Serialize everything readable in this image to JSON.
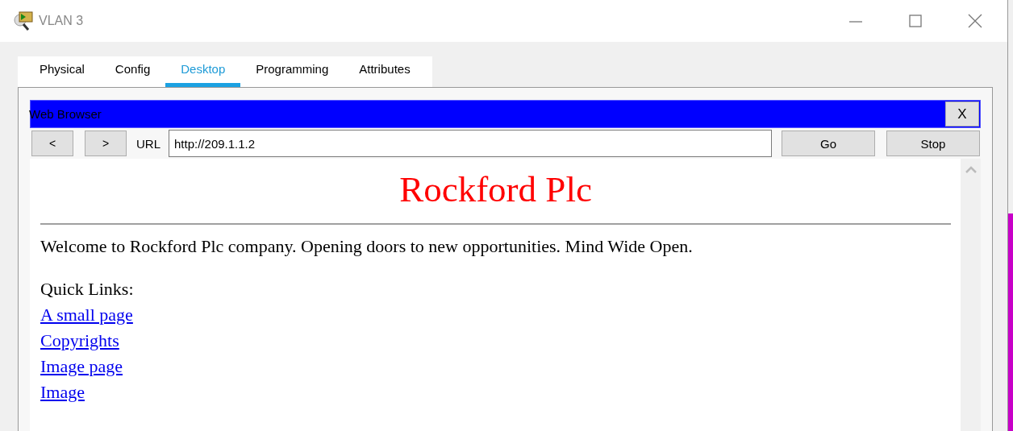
{
  "window": {
    "title": "VLAN 3"
  },
  "tabs": [
    {
      "label": "Physical",
      "selected": false
    },
    {
      "label": "Config",
      "selected": false
    },
    {
      "label": "Desktop",
      "selected": true
    },
    {
      "label": "Programming",
      "selected": false
    },
    {
      "label": "Attributes",
      "selected": false
    }
  ],
  "browser": {
    "title": "Web Browser",
    "close_label": "X",
    "back_label": "<",
    "forward_label": ">",
    "url_label": "URL",
    "url": "http://209.1.1.2",
    "go_label": "Go",
    "stop_label": "Stop"
  },
  "page": {
    "heading": "Rockford Plc",
    "text": "Welcome to Rockford Plc company. Opening doors to new opportunities. Mind Wide Open.",
    "links_label": "Quick Links:",
    "links": [
      "A small page",
      "Copyrights",
      "Image page",
      "Image"
    ]
  }
}
